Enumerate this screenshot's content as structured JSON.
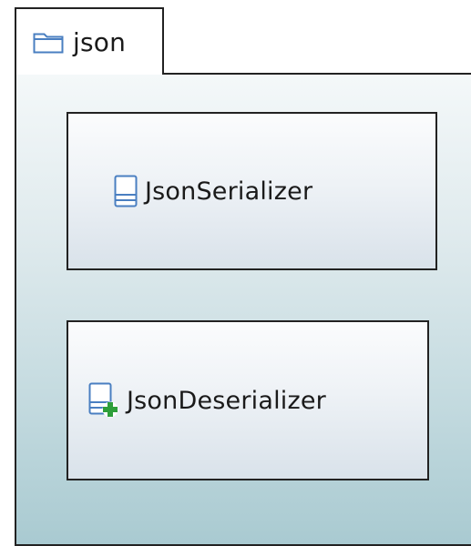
{
  "package": {
    "name": "json",
    "icon": "folder-icon"
  },
  "elements": [
    {
      "name": "JsonSerializer",
      "icon": "interface-icon"
    },
    {
      "name": "JsonDeserializer",
      "icon": "interface-add-icon"
    }
  ],
  "colors": {
    "border": "#222222",
    "icon_blue": "#4a7fc1",
    "add_green": "#2e9e3a",
    "package_fill_top": "#f4f8f9",
    "package_fill_bottom": "#a9cad1"
  }
}
